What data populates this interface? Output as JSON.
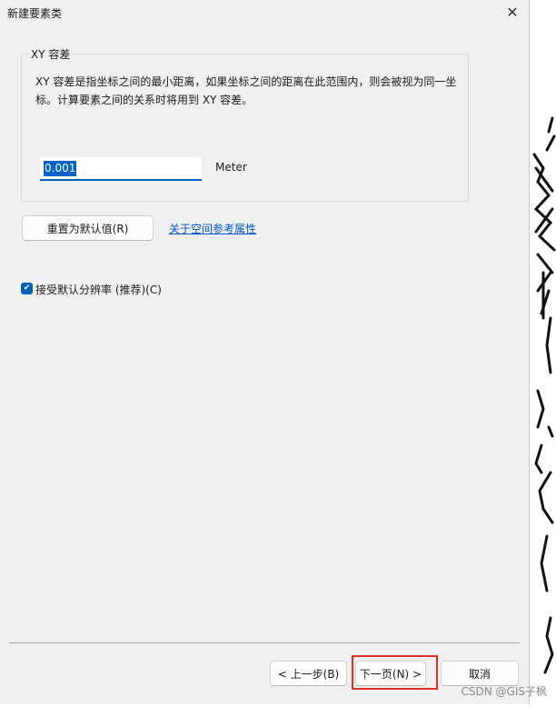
{
  "window": {
    "title": "新建要素类",
    "close_glyph": "✕"
  },
  "tolerance_group": {
    "title": "XY 容差",
    "description": "XY 容差是指坐标之间的最小距离，如果坐标之间的距离在此范围内，则会被视为同一坐标。计算要素之间的关系时将用到 XY 容差。",
    "value": "0.001",
    "unit": "Meter"
  },
  "reset_button": "重置为默认值(R)",
  "spatial_ref_link": "关于空间参考属性",
  "accept_default": {
    "checked": true,
    "label": "接受默认分辨率 (推荐)(C)"
  },
  "footer": {
    "back_button": "< 上一步(B)",
    "next_button": "下一页(N) >",
    "cancel_button": "取消"
  },
  "watermark": "CSDN @GIS子枫",
  "colors": {
    "accent": "#005fb8",
    "highlight_border": "#e0302a",
    "link": "#0055c8"
  }
}
